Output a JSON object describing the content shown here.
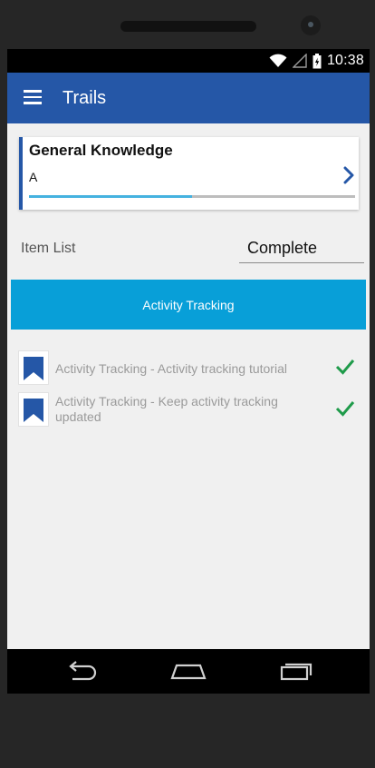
{
  "status_bar": {
    "time": "10:38",
    "icons": [
      "wifi-icon",
      "signal-icon",
      "battery-icon"
    ]
  },
  "app_bar": {
    "title": "Trails",
    "color": "#2557a7"
  },
  "trail_card": {
    "title": "General Knowledge",
    "subtitle": "A",
    "progress_fraction": 0.5,
    "progress_color": "#45b2e0",
    "accent_color": "#2557a7"
  },
  "filter": {
    "label": "Item List",
    "selected_value": "Complete"
  },
  "category_button": {
    "label": "Activity Tracking",
    "color": "#089fd8"
  },
  "items": [
    {
      "title": "Activity Tracking - Activity tracking tutorial",
      "status_icon": "check-icon",
      "icon": "bookmark-icon"
    },
    {
      "title": "Activity Tracking - Keep activity tracking updated",
      "status_icon": "check-icon",
      "icon": "bookmark-icon"
    }
  ],
  "colors": {
    "check": "#1f9b4a",
    "bookmark": "#2557a7"
  },
  "nav_bar": {
    "buttons": [
      "back-icon",
      "home-icon",
      "recents-icon"
    ]
  }
}
